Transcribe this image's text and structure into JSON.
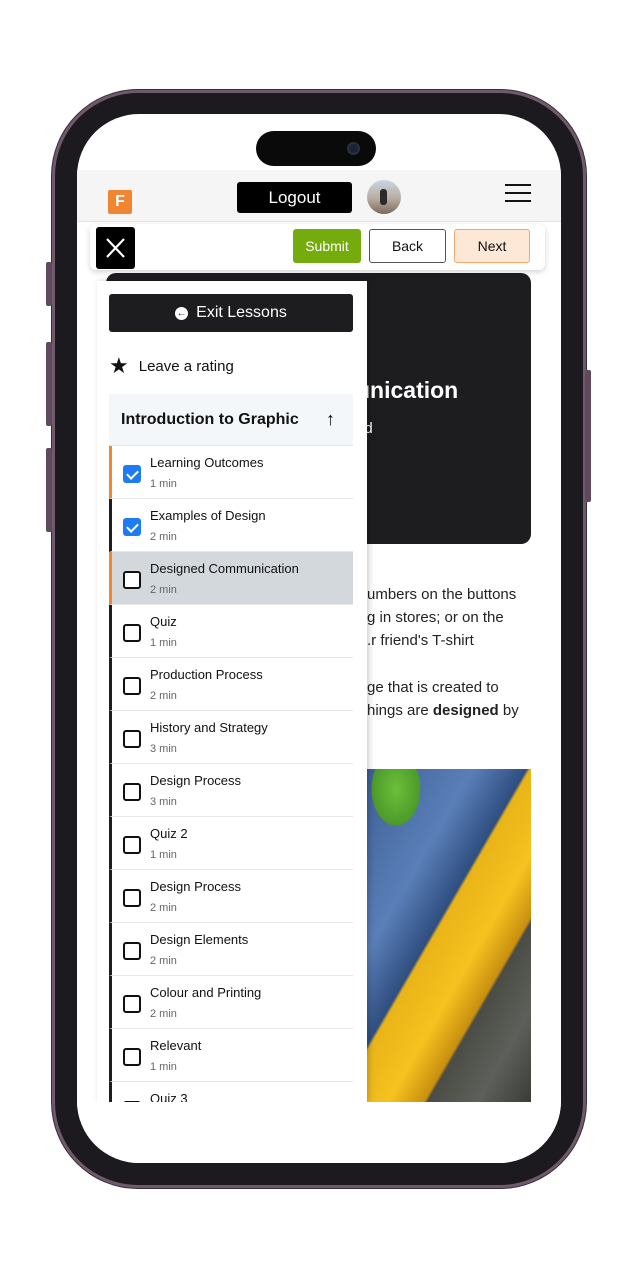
{
  "header": {
    "logo_letter": "F",
    "logout_label": "Logout",
    "menu_icon": "hamburger-icon"
  },
  "toolbar": {
    "close_icon": "close-icon",
    "submit_label": "Submit",
    "back_label": "Back",
    "next_label": "Next"
  },
  "colors": {
    "accent": "#f08532",
    "submit": "#73ac0c",
    "checkbox": "#1e7bf2",
    "dark": "#1d1d1f"
  },
  "hero": {
    "title_visible": "unication",
    "subtitle_visible": "ad"
  },
  "body": {
    "lines": [
      "umbers on the buttons",
      "g in stores; or on the",
      "r friend's T-shirt.",
      "ge that is created to"
    ],
    "line5_pre": "hings are ",
    "line5_bold": "designed",
    "line5_post": " by"
  },
  "sidebar": {
    "exit_label": "Exit Lessons",
    "rating_label": "Leave a rating",
    "section_title": "Introduction to Graphic",
    "lessons": [
      {
        "title": "Learning Outcomes",
        "duration": "1 min",
        "done": true
      },
      {
        "title": "Examples of Design",
        "duration": "2 min",
        "done": true
      },
      {
        "title": "Designed Communication",
        "duration": "2 min",
        "done": false,
        "current": true
      },
      {
        "title": "Quiz",
        "duration": "1 min",
        "done": false
      },
      {
        "title": "Production Process",
        "duration": "2 min",
        "done": false
      },
      {
        "title": "History and Strategy",
        "duration": "3 min",
        "done": false
      },
      {
        "title": "Design Process",
        "duration": "3 min",
        "done": false
      },
      {
        "title": "Quiz 2",
        "duration": "1 min",
        "done": false
      },
      {
        "title": "Design Process",
        "duration": "2 min",
        "done": false
      },
      {
        "title": "Design Elements",
        "duration": "2 min",
        "done": false
      },
      {
        "title": "Colour and Printing",
        "duration": "2 min",
        "done": false
      },
      {
        "title": "Relevant",
        "duration": "1 min",
        "done": false
      },
      {
        "title": "Quiz 3",
        "duration": "",
        "done": false
      }
    ]
  }
}
